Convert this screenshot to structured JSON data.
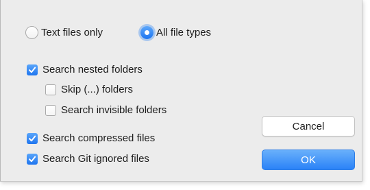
{
  "file_type": {
    "options": [
      {
        "label": "Text files only",
        "selected": false
      },
      {
        "label": "All file types",
        "selected": true
      }
    ]
  },
  "options": {
    "search_nested_folders": {
      "label": "Search nested folders",
      "checked": true
    },
    "skip_folders": {
      "label": "Skip (...) folders",
      "checked": false
    },
    "search_invisible_folders": {
      "label": "Search invisible folders",
      "checked": false
    },
    "search_compressed_files": {
      "label": "Search compressed files",
      "checked": true
    },
    "search_git_ignored_files": {
      "label": "Search Git ignored files",
      "checked": true
    }
  },
  "buttons": {
    "cancel_label": "Cancel",
    "ok_label": "OK"
  },
  "colors": {
    "accent": "#1f75ef",
    "dialog_background": "#ececec"
  }
}
